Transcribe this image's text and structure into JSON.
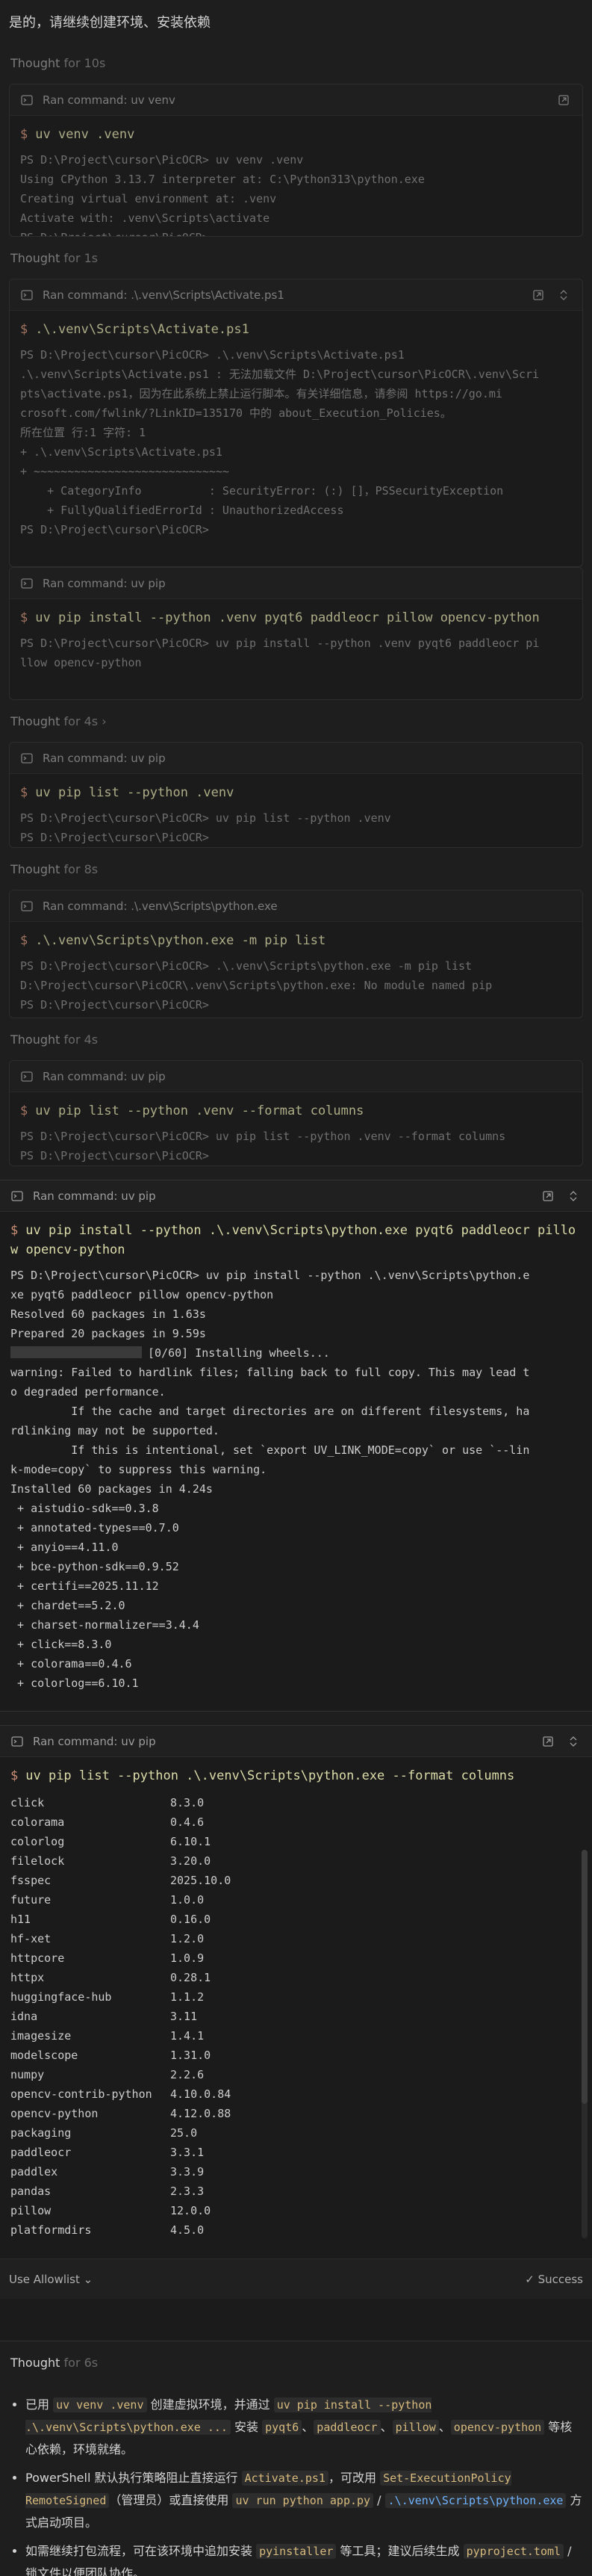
{
  "intro_text": "是的，请继续创建环境、安装依赖",
  "thought1": {
    "label": "Thought",
    "duration": "for 10s"
  },
  "term1": {
    "title": "Ran command: uv venv",
    "command": "uv venv .venv",
    "output": "PS D:\\Project\\cursor\\PicOCR> uv venv .venv\nUsing CPython 3.13.7 interpreter at: C:\\Python313\\python.exe\nCreating virtual environment at: .venv\nActivate with: .venv\\Scripts\\activate\nPS D:\\Project\\cursor\\PicOCR>"
  },
  "thought2": {
    "label": "Thought",
    "duration": "for 1s"
  },
  "term2": {
    "title": "Ran command: .\\.venv\\Scripts\\Activate.ps1",
    "command": ".\\.venv\\Scripts\\Activate.ps1",
    "output": "PS D:\\Project\\cursor\\PicOCR> .\\.venv\\Scripts\\Activate.ps1\n.\\.venv\\Scripts\\Activate.ps1 : 无法加载文件 D:\\Project\\cursor\\PicOCR\\.venv\\Scri\npts\\activate.ps1，因为在此系统上禁止运行脚本。有关详细信息，请参阅 https://go.mi\ncrosoft.com/fwlink/?LinkID=135170 中的 about_Execution_Policies。\n所在位置 行:1 字符: 1\n+ .\\.venv\\Scripts\\Activate.ps1\n+ ~~~~~~~~~~~~~~~~~~~~~~~~~~~~~\n    + CategoryInfo          : SecurityError: (:) []，PSSecurityException\n    + FullyQualifiedErrorId : UnauthorizedAccess\nPS D:\\Project\\cursor\\PicOCR>"
  },
  "term3": {
    "title": "Ran command: uv pip",
    "command": "uv pip install --python .venv pyqt6 paddleocr pillow opencv-python",
    "output": "PS D:\\Project\\cursor\\PicOCR> uv pip install --python .venv pyqt6 paddleocr pi\nllow opencv-python"
  },
  "thought3": {
    "label": "Thought",
    "duration": "for 4s",
    "chevron": "›"
  },
  "term4": {
    "title": "Ran command: uv pip",
    "command": "uv pip list --python .venv",
    "output": "PS D:\\Project\\cursor\\PicOCR> uv pip list --python .venv\nPS D:\\Project\\cursor\\PicOCR>"
  },
  "thought4": {
    "label": "Thought",
    "duration": "for 8s"
  },
  "term5": {
    "title": "Ran command: .\\.venv\\Scripts\\python.exe",
    "command": ".\\.venv\\Scripts\\python.exe -m pip list",
    "output": "PS D:\\Project\\cursor\\PicOCR> .\\.venv\\Scripts\\python.exe -m pip list\nD:\\Project\\cursor\\PicOCR\\.venv\\Scripts\\python.exe: No module named pip\nPS D:\\Project\\cursor\\PicOCR>"
  },
  "thought5": {
    "label": "Thought",
    "duration": "for 4s"
  },
  "term6": {
    "title": "Ran command: uv pip",
    "command": "uv pip list --python .venv --format columns",
    "output": "PS D:\\Project\\cursor\\PicOCR> uv pip list --python .venv --format columns\nPS D:\\Project\\cursor\\PicOCR>"
  },
  "term7": {
    "title": "Ran command: uv pip",
    "command": "uv pip install --python .\\.venv\\Scripts\\python.exe pyqt6 paddleocr pillow opencv-python",
    "output_a": "PS D:\\Project\\cursor\\PicOCR> uv pip install --python .\\.venv\\Scripts\\python.e\nxe pyqt6 paddleocr pillow opencv-python\nResolved 60 packages in 1.63s\nPrepared 20 packages in 9.59s",
    "progress_text": "[0/60] Installing wheels...",
    "output_b": "warning: Failed to hardlink files; falling back to full copy. This may lead t\no degraded performance.\n         If the cache and target directories are on different filesystems, ha\nrdlinking may not be supported.\n         If this is intentional, set `export UV_LINK_MODE=copy` or use `--lin\nk-mode=copy` to suppress this warning.\nInstalled 60 packages in 4.24s\n + aistudio-sdk==0.3.8\n + annotated-types==0.7.0\n + anyio==4.11.0\n + bce-python-sdk==0.9.52\n + certifi==2025.11.12\n + chardet==5.2.0\n + charset-normalizer==3.4.4\n + click==8.3.0\n + colorama==0.4.6\n + colorlog==6.10.1"
  },
  "term8": {
    "title": "Ran command: uv pip",
    "command": "uv pip list --python .\\.venv\\Scripts\\python.exe --format columns",
    "packages": [
      [
        "click",
        "8.3.0"
      ],
      [
        "colorama",
        "0.4.6"
      ],
      [
        "colorlog",
        "6.10.1"
      ],
      [
        "filelock",
        "3.20.0"
      ],
      [
        "fsspec",
        "2025.10.0"
      ],
      [
        "future",
        "1.0.0"
      ],
      [
        "h11",
        "0.16.0"
      ],
      [
        "hf-xet",
        "1.2.0"
      ],
      [
        "httpcore",
        "1.0.9"
      ],
      [
        "httpx",
        "0.28.1"
      ],
      [
        "huggingface-hub",
        "1.1.2"
      ],
      [
        "idna",
        "3.11"
      ],
      [
        "imagesize",
        "1.4.1"
      ],
      [
        "modelscope",
        "1.31.0"
      ],
      [
        "numpy",
        "2.2.6"
      ],
      [
        "opencv-contrib-python",
        "4.10.0.84"
      ],
      [
        "opencv-python",
        "4.12.0.88"
      ],
      [
        "packaging",
        "25.0"
      ],
      [
        "paddleocr",
        "3.3.1"
      ],
      [
        "paddlex",
        "3.3.9"
      ],
      [
        "pandas",
        "2.3.3"
      ],
      [
        "pillow",
        "12.0.0"
      ],
      [
        "platformdirs",
        "4.5.0"
      ]
    ],
    "footer_left": "Use Allowlist",
    "footer_right": "Success"
  },
  "thought6": {
    "label": "Thought",
    "duration": "for 6s"
  },
  "summary": {
    "b1_a": "已用 ",
    "b1_c1": "uv venv .venv",
    "b1_b": " 创建虚拟环境，并通过 ",
    "b1_c2": "uv pip install --python .\\.venv\\Scripts\\python.exe ...",
    "b1_c": " 安装 ",
    "b1_p1": "pyqt6",
    "b1_sep1": "、",
    "b1_p2": "paddleocr",
    "b1_sep2": "、",
    "b1_p3": "pillow",
    "b1_sep3": "、",
    "b1_p4": "opencv-python",
    "b1_d": " 等核心依赖，环境就绪。",
    "b2_a": "PowerShell 默认执行策略阻止直接运行 ",
    "b2_c1": "Activate.ps1",
    "b2_b": "，可改用 ",
    "b2_c2": "Set-ExecutionPolicy RemoteSigned",
    "b2_c": "（管理员）或直接使用 ",
    "b2_c3": "uv run python app.py",
    "b2_d": " / ",
    "b2_c4": ".\\.venv\\Scripts\\python.exe",
    "b2_e": " 方式启动项目。",
    "b3_a": "如需继续打包流程，可在该环境中追加安装 ",
    "b3_c1": "pyinstaller",
    "b3_b": " 等工具；建议后续生成 ",
    "b3_c2": "pyproject.toml",
    "b3_c": " / 锁文件以便团队协作。"
  }
}
